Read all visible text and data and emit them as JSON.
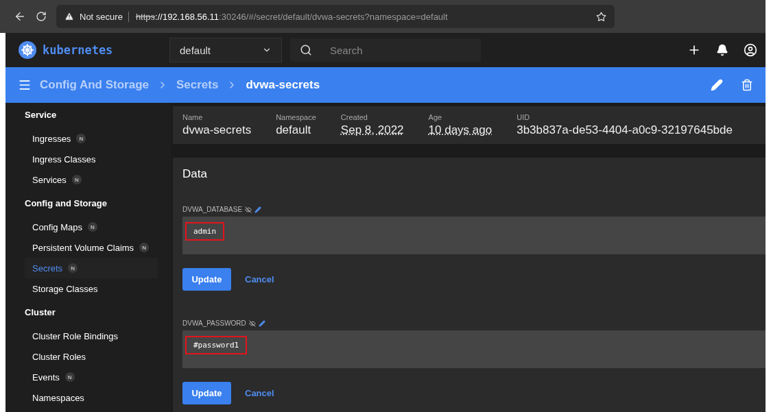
{
  "browser": {
    "security": "Not secure",
    "url_scheme": "https",
    "url_host": "://192.168.56.11",
    "url_rest": ":30246/#/secret/default/dvwa-secrets?namespace=default"
  },
  "app": {
    "logo": "kubernetes",
    "namespace": "default",
    "search": {
      "placeholder": "Search"
    }
  },
  "breadcrumbs": [
    {
      "label": "Config And Storage",
      "current": false
    },
    {
      "label": "Secrets",
      "current": false
    },
    {
      "label": "dvwa-secrets",
      "current": true
    }
  ],
  "sidebar": [
    {
      "title": "Service",
      "items": [
        {
          "label": "Ingresses",
          "badge": "N",
          "selected": false
        },
        {
          "label": "Ingress Classes",
          "selected": false
        },
        {
          "label": "Services",
          "badge": "N",
          "selected": false
        }
      ]
    },
    {
      "title": "Config and Storage",
      "items": [
        {
          "label": "Config Maps",
          "badge": "N",
          "selected": false
        },
        {
          "label": "Persistent Volume Claims",
          "badge": "N",
          "selected": false
        },
        {
          "label": "Secrets",
          "badge": "N",
          "selected": true
        },
        {
          "label": "Storage Classes",
          "selected": false
        }
      ]
    },
    {
      "title": "Cluster",
      "items": [
        {
          "label": "Cluster Role Bindings",
          "selected": false
        },
        {
          "label": "Cluster Roles",
          "selected": false
        },
        {
          "label": "Events",
          "badge": "N",
          "selected": false
        },
        {
          "label": "Namespaces",
          "selected": false
        }
      ]
    }
  ],
  "metadata": [
    {
      "label": "Name",
      "value": "dvwa-secrets",
      "dotted": false
    },
    {
      "label": "Namespace",
      "value": "default",
      "dotted": false
    },
    {
      "label": "Created",
      "value": "Sep 8, 2022",
      "dotted": true
    },
    {
      "label": "Age",
      "value": "10 days ago",
      "dotted": true
    },
    {
      "label": "UID",
      "value": "3b3b837a-de53-4404-a0c9-32197645bde",
      "dotted": false
    }
  ],
  "data": {
    "title": "Data",
    "entries": [
      {
        "key": "DVWA_DATABASE",
        "value": "admin",
        "highlighted": true,
        "update": "Update",
        "cancel": "Cancel"
      },
      {
        "key": "DVWA_PASSWORD",
        "value": "#password1",
        "highlighted": true,
        "update": "Update",
        "cancel": "Cancel"
      }
    ]
  }
}
